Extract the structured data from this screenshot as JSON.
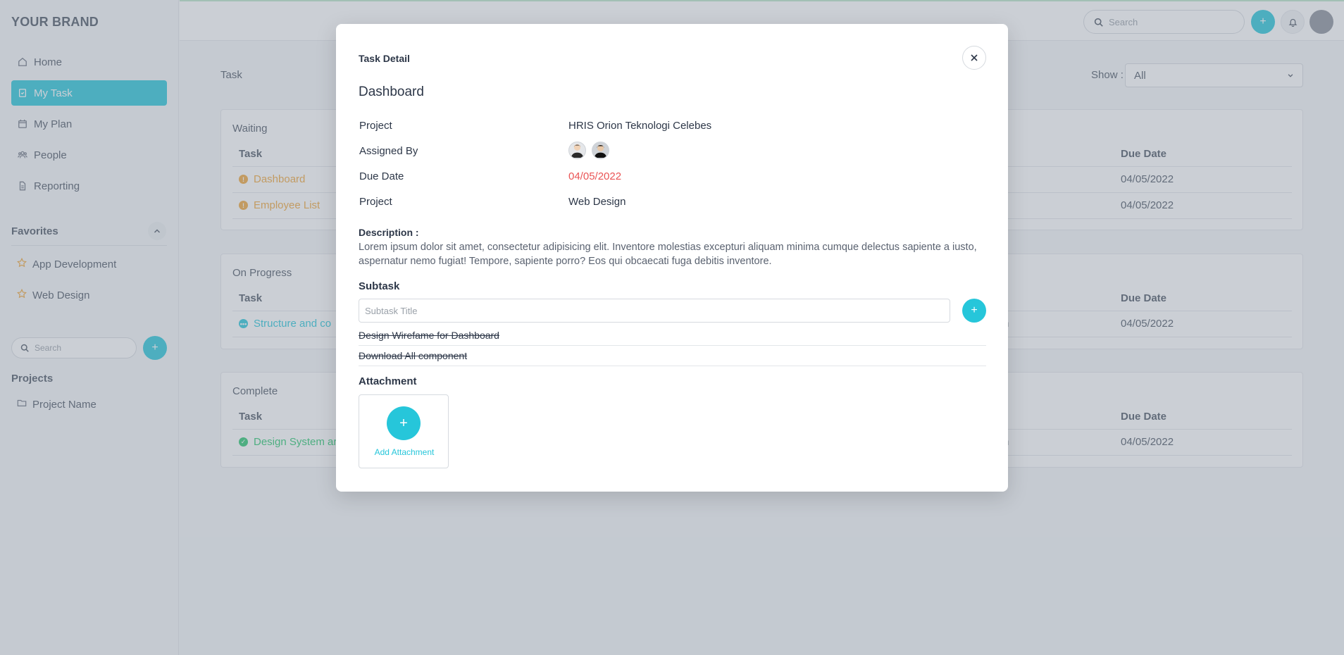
{
  "brand": "YOUR BRAND",
  "sidebar": {
    "nav": [
      {
        "label": "Home",
        "icon": "home-icon"
      },
      {
        "label": "My Task",
        "icon": "task-icon",
        "active": true
      },
      {
        "label": "My Plan",
        "icon": "calendar-icon"
      },
      {
        "label": "People",
        "icon": "people-icon"
      },
      {
        "label": "Reporting",
        "icon": "report-icon"
      }
    ],
    "favorites_title": "Favorites",
    "favorites": [
      "App Development",
      "Web Design"
    ],
    "search_placeholder": "Search",
    "projects_title": "Projects",
    "projects": [
      "Project Name"
    ]
  },
  "topbar": {
    "search_placeholder": "Search"
  },
  "main": {
    "title": "Task",
    "show_label": "Show :",
    "show_value": "All",
    "groups": [
      {
        "title": "Waiting",
        "col_task": "Task",
        "col_due": "Due Date",
        "rows": [
          {
            "task": "Dashboard",
            "mid": "",
            "due": "04/05/2022"
          },
          {
            "task": "Employee List",
            "mid": "",
            "due": "04/05/2022"
          }
        ]
      },
      {
        "title": "On Progress",
        "col_task": "Task",
        "col_due": "Due Date",
        "rows": [
          {
            "task": "Structure and co",
            "mid": "n",
            "due": "04/05/2022"
          }
        ]
      },
      {
        "title": "Complete",
        "col_task": "Task",
        "col_due": "Due Date",
        "rows": [
          {
            "task": "Design System ar",
            "mid": "n",
            "due": "04/05/2022"
          }
        ]
      }
    ]
  },
  "modal": {
    "header": "Task Detail",
    "title": "Dashboard",
    "meta": [
      {
        "label": "Project",
        "value": "HRIS Orion Teknologi Celebes"
      },
      {
        "label": "Assigned By",
        "value": ""
      },
      {
        "label": "Due Date",
        "value": "04/05/2022"
      },
      {
        "label": "Project",
        "value": "Web Design"
      }
    ],
    "description_label": "Description :",
    "description": "Lorem ipsum dolor sit amet, consectetur adipisicing elit. Inventore molestias excepturi aliquam minima cumque delectus sapiente a iusto, aspernatur nemo fugiat! Tempore, sapiente porro? Eos qui obcaecati fuga debitis inventore.",
    "subtask_label": "Subtask",
    "subtask_placeholder": "Subtask Title",
    "subtasks": [
      "Design Wirefame for Dashboard",
      "Download All component"
    ],
    "attachment_label": "Attachment",
    "add_attachment": "Add Attachment"
  },
  "colors": {
    "accent": "#26c6da",
    "warning": "#f0a63a",
    "success": "#28c76f",
    "danger": "#ea5455"
  }
}
